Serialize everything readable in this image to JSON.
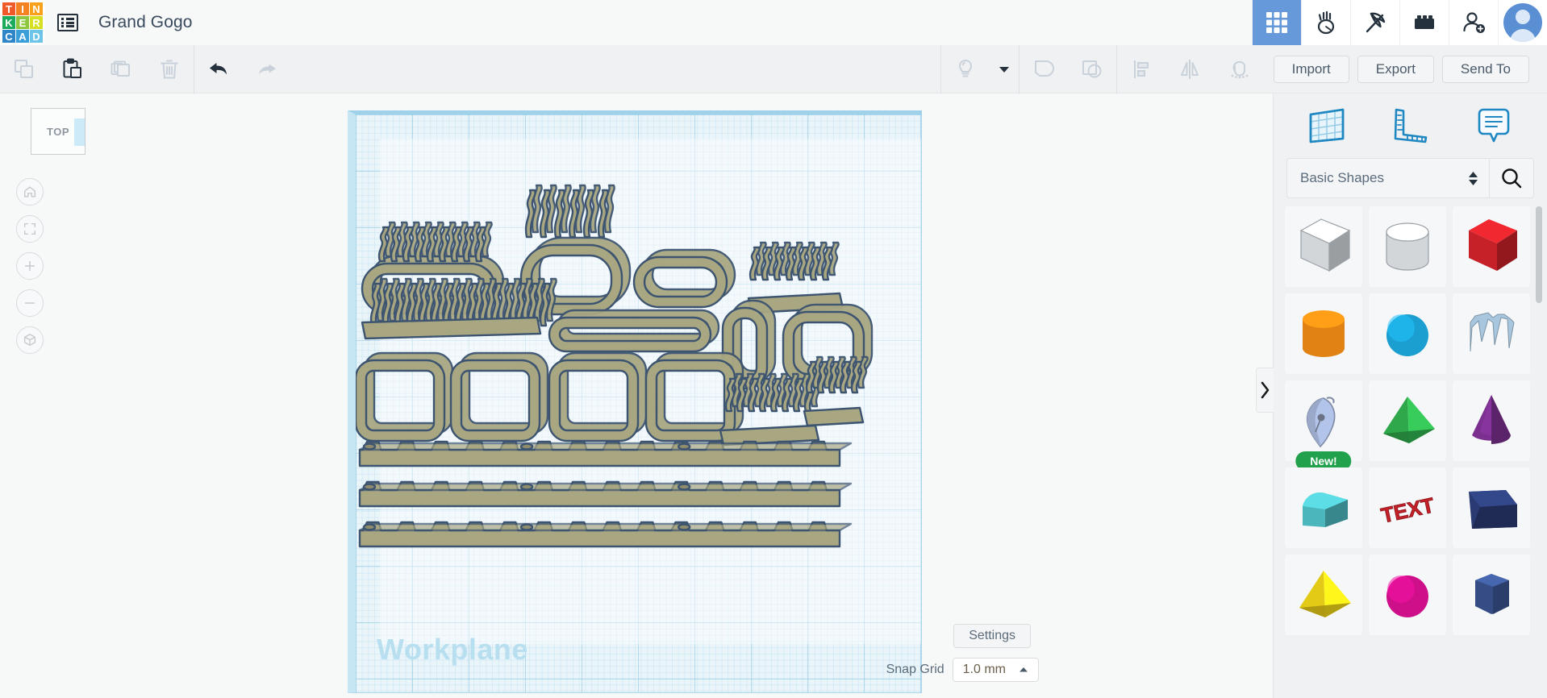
{
  "app": {
    "name": "Tinkercad",
    "logo_letters": [
      {
        "ch": "T",
        "color": "#f05a28"
      },
      {
        "ch": "I",
        "color": "#f58220"
      },
      {
        "ch": "N",
        "color": "#f9a11b"
      },
      {
        "ch": "K",
        "color": "#1cab5d"
      },
      {
        "ch": "E",
        "color": "#8dc63f"
      },
      {
        "ch": "R",
        "color": "#d7df23"
      },
      {
        "ch": "C",
        "color": "#2e86c8"
      },
      {
        "ch": "A",
        "color": "#3a9fd8"
      },
      {
        "ch": "D",
        "color": "#6cc5e8"
      }
    ],
    "project_title": "Grand Gogo",
    "project_menu_icon": "list-menu-icon"
  },
  "topbar": {
    "icons": [
      {
        "name": "apps-grid-icon",
        "label": "3D Design",
        "active": true
      },
      {
        "name": "codeblocks-icon",
        "label": "Codeblocks",
        "active": false
      },
      {
        "name": "pickaxe-icon",
        "label": "Minecraft",
        "active": false
      },
      {
        "name": "lego-brick-icon",
        "label": "Bricks",
        "active": false
      },
      {
        "name": "invite-person-icon",
        "label": "Invite people",
        "active": false
      }
    ],
    "avatar_name": "user-avatar"
  },
  "toolbar": {
    "left_tools": [
      {
        "name": "copy-button",
        "icon": "copy-icon",
        "enabled": false
      },
      {
        "name": "paste-button",
        "icon": "paste-icon",
        "enabled": true
      },
      {
        "name": "duplicate-button",
        "icon": "duplicate-icon",
        "enabled": false
      },
      {
        "name": "delete-button",
        "icon": "trash-icon",
        "enabled": false
      },
      {
        "name": "undo-button",
        "icon": "undo-arrow-icon",
        "enabled": true
      },
      {
        "name": "redo-button",
        "icon": "redo-arrow-icon",
        "enabled": false
      }
    ],
    "right_tools": [
      {
        "name": "light-bulb-button",
        "icon": "light-bulb-icon",
        "enabled": false
      },
      {
        "name": "light-bulb-dropdown",
        "icon": "caret-down-icon",
        "enabled": true
      },
      {
        "name": "group-button",
        "icon": "group-icon",
        "enabled": false
      },
      {
        "name": "ungroup-button",
        "icon": "ungroup-icon",
        "enabled": false
      },
      {
        "name": "align-button",
        "icon": "align-icon",
        "enabled": false
      },
      {
        "name": "mirror-button",
        "icon": "mirror-flip-icon",
        "enabled": false
      },
      {
        "name": "magnet-button",
        "icon": "magnet-snap-icon",
        "enabled": false
      }
    ],
    "import_label": "Import",
    "export_label": "Export",
    "sendto_label": "Send To"
  },
  "canvas": {
    "viewcube_label": "TOP",
    "workplane_label": "Workplane",
    "nav_buttons": [
      {
        "name": "home-view-button",
        "icon": "home-icon"
      },
      {
        "name": "fit-to-view-button",
        "icon": "fit-frame-icon"
      },
      {
        "name": "zoom-in-button",
        "icon": "plus-icon"
      },
      {
        "name": "zoom-out-button",
        "icon": "minus-icon"
      },
      {
        "name": "perspective-toggle-button",
        "icon": "cube-arrow-icon"
      }
    ],
    "settings_label": "Settings",
    "snap_grid_label": "Snap Grid",
    "snap_grid_value": "1.0 mm",
    "model_fill": "#a9a782",
    "model_stroke": "#3d5470"
  },
  "right_panel": {
    "tabs": [
      {
        "name": "tab-workplane",
        "icon": "workplane-grid-icon",
        "label": "Workplane"
      },
      {
        "name": "tab-ruler",
        "icon": "ruler-icon",
        "label": "Ruler"
      },
      {
        "name": "tab-notes",
        "icon": "note-bubble-icon",
        "label": "Notes"
      }
    ],
    "category_value": "Basic Shapes",
    "search_icon": "search-icon",
    "collapse_icon": "chevron-right-icon",
    "shapes": [
      {
        "name": "shape-box-hole",
        "label": "Box Hole",
        "render": "box",
        "color": "#d2d6d9",
        "hole": true
      },
      {
        "name": "shape-cylinder-hole",
        "label": "Cylinder Hole",
        "render": "cylinder",
        "color": "#d2d6d9",
        "hole": true
      },
      {
        "name": "shape-box",
        "label": "Box",
        "render": "box",
        "color": "#c62128",
        "hole": false
      },
      {
        "name": "shape-cylinder",
        "label": "Cylinder",
        "render": "cylinder",
        "color": "#e08214",
        "hole": false
      },
      {
        "name": "shape-sphere",
        "label": "Sphere",
        "render": "sphere",
        "color": "#1b9fd0",
        "hole": false
      },
      {
        "name": "shape-scribble",
        "label": "Scribble",
        "render": "scribble",
        "color": "#a8c6de",
        "hole": false
      },
      {
        "name": "shape-generator-pen",
        "label": "Shape Generator",
        "render": "pen",
        "color": "#b3c4ea",
        "hole": false,
        "badge": "New!"
      },
      {
        "name": "shape-pyramid",
        "label": "Pyramid",
        "render": "pyramid",
        "color": "#2ea84a",
        "hole": false
      },
      {
        "name": "shape-cone",
        "label": "Cone",
        "render": "cone",
        "color": "#7b2f8e",
        "hole": false
      },
      {
        "name": "shape-roof",
        "label": "Roof",
        "render": "roof",
        "color": "#4cb6bd",
        "hole": false
      },
      {
        "name": "shape-text",
        "label": "Text",
        "render": "text",
        "color": "#c62128",
        "hole": false,
        "text": "TEXT"
      },
      {
        "name": "shape-wedge",
        "label": "Wedge",
        "render": "wedge",
        "color": "#2a3a72",
        "hole": false
      },
      {
        "name": "shape-pyramid-yellow",
        "label": "Pyramid",
        "render": "pyramid",
        "color": "#e3ca17",
        "hole": false
      },
      {
        "name": "shape-half-sphere",
        "label": "Half Sphere",
        "render": "sphere",
        "color": "#cd0f8a",
        "hole": false
      },
      {
        "name": "shape-polygon",
        "label": "Polygon",
        "render": "polygon",
        "color": "#3a5490",
        "hole": false
      }
    ]
  }
}
